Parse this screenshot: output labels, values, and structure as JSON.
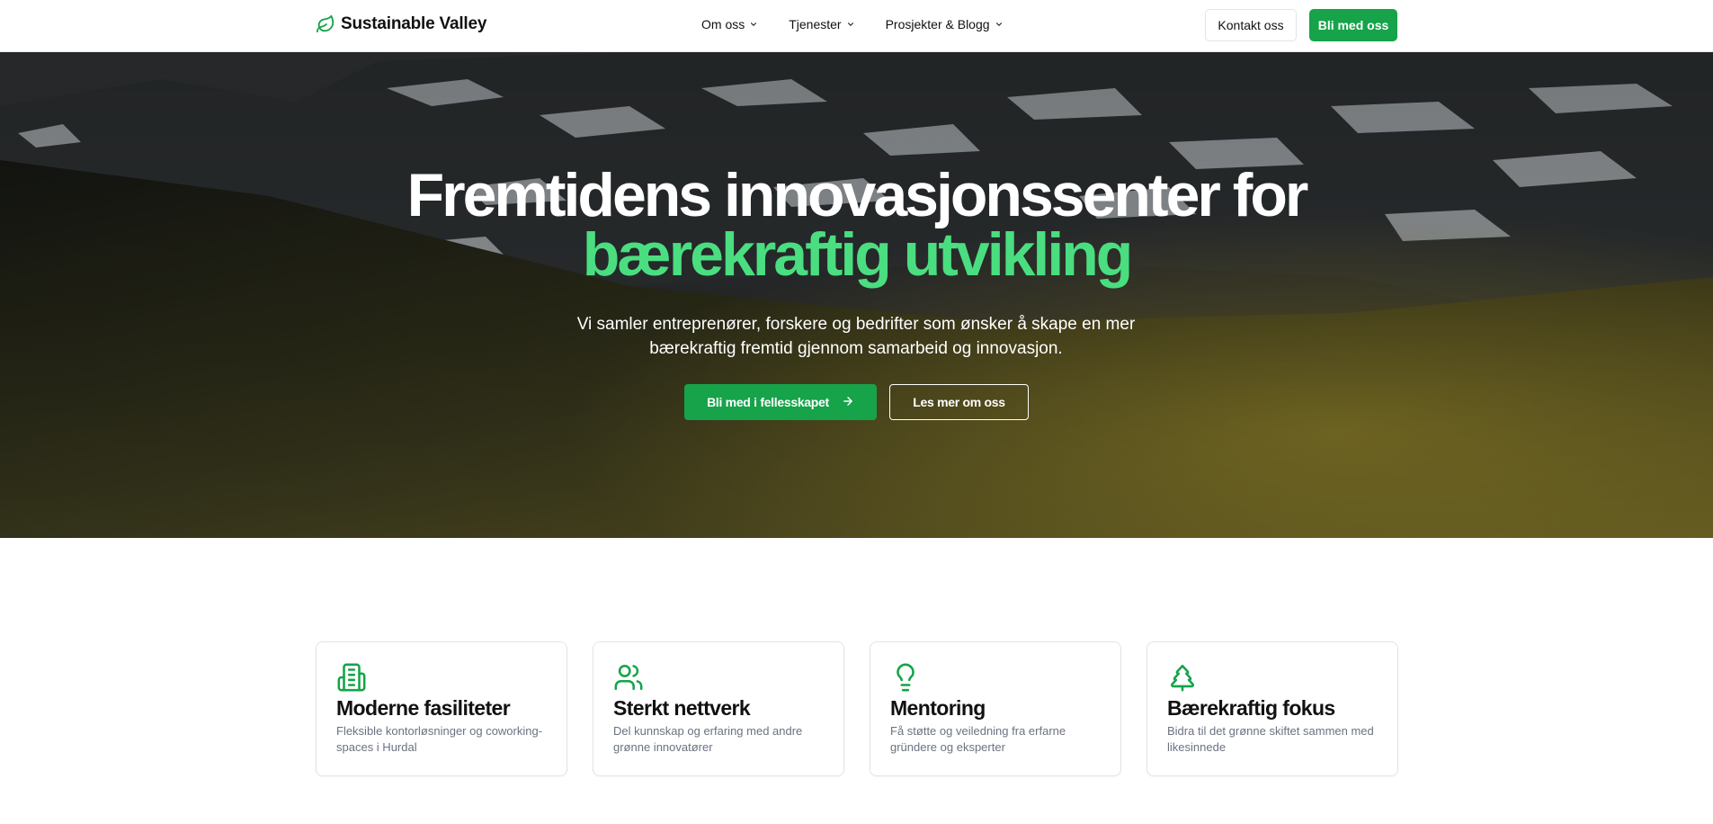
{
  "header": {
    "brand": "Sustainable Valley",
    "nav": [
      {
        "label": "Om oss"
      },
      {
        "label": "Tjenester"
      },
      {
        "label": "Prosjekter & Blogg"
      }
    ],
    "contact_label": "Kontakt oss",
    "join_label": "Bli med oss"
  },
  "hero": {
    "title_line1": "Fremtidens innovasjonssenter for",
    "title_line2": "bærekraftig utvikling",
    "subtitle": "Vi samler entreprenører, forskere og bedrifter som ønsker å skape en mer bærekraftig fremtid gjennom samarbeid og innovasjon.",
    "primary_cta": "Bli med i fellesskapet",
    "secondary_cta": "Les mer om oss"
  },
  "features": [
    {
      "icon": "building-icon",
      "title": "Moderne fasiliteter",
      "desc": "Fleksible kontorløsninger og coworking-spaces i Hurdal"
    },
    {
      "icon": "users-icon",
      "title": "Sterkt nettverk",
      "desc": "Del kunnskap og erfaring med andre grønne innovatører"
    },
    {
      "icon": "lightbulb-icon",
      "title": "Mentoring",
      "desc": "Få støtte og veiledning fra erfarne gründere og eksperter"
    },
    {
      "icon": "tree-icon",
      "title": "Bærekraftig fokus",
      "desc": "Bidra til det grønne skiftet sammen med likesinnede"
    }
  ],
  "colors": {
    "accent": "#16a34a",
    "accent_light": "#4ade80",
    "text": "#111111",
    "muted": "#6b7280"
  }
}
